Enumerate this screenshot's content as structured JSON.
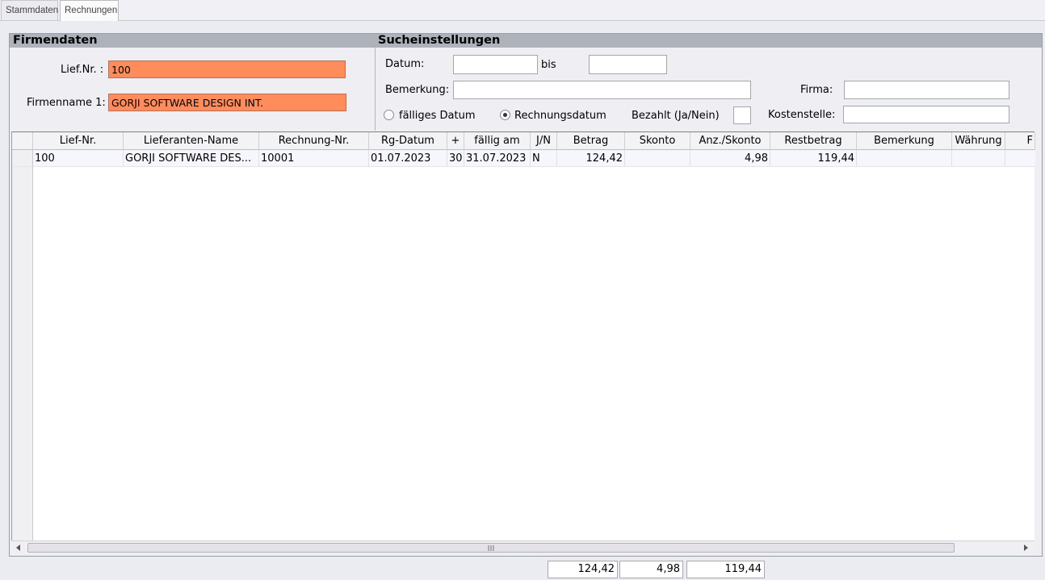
{
  "tabs": [
    {
      "label": "Stammdaten",
      "active": false
    },
    {
      "label": "Rechnungen",
      "active": true
    }
  ],
  "firmendaten": {
    "title": "Firmendaten",
    "lief_nr_label": "Lief.Nr. :",
    "lief_nr_value": "100",
    "firmenname_label": "Firmenname 1:",
    "firmenname_value": "GORJI SOFTWARE DESIGN INT."
  },
  "sucheinstellungen": {
    "title": "Sucheinstellungen",
    "datum_label": "Datum:",
    "datum_from": "",
    "bis_label": "bis",
    "datum_to": "",
    "bemerkung_label": "Bemerkung:",
    "bemerkung_value": "",
    "firma_label": "Firma:",
    "firma_value": "",
    "radio_faelliges": "fälliges Datum",
    "radio_rechnungsdatum": "Rechnungsdatum",
    "radio_selected": "Rechnungsdatum",
    "bezahlt_label": "Bezahlt (Ja/Nein)",
    "bezahlt_value": "",
    "kostenstelle_label": "Kostenstelle:",
    "kostenstelle_value": ""
  },
  "grid": {
    "columns": [
      "Lief-Nr.",
      "Lieferanten-Name",
      "Rechnung-Nr.",
      "Rg-Datum",
      "+",
      "fällig am",
      "J/N",
      "Betrag",
      "Skonto",
      "Anz./Skonto",
      "Restbetrag",
      "Bemerkung",
      "Währung",
      "F"
    ],
    "rows": [
      {
        "lief_nr": "100",
        "name": "GORJI SOFTWARE DES...",
        "rechnung_nr": "10001",
        "rg_datum": "01.07.2023",
        "plus": "30",
        "faellig_am": "31.07.2023",
        "jn": "N",
        "betrag": "124,42",
        "skonto": "",
        "anz_skonto": "4,98",
        "restbetrag": "119,44",
        "bemerkung": "",
        "waehrung": "",
        "f": ""
      }
    ]
  },
  "totals": {
    "betrag": "124,42",
    "skonto": "4,98",
    "restbetrag": "119,44"
  },
  "colors": {
    "highlight_field": "#ff8c5a",
    "section_header": "#aeb2bb"
  }
}
